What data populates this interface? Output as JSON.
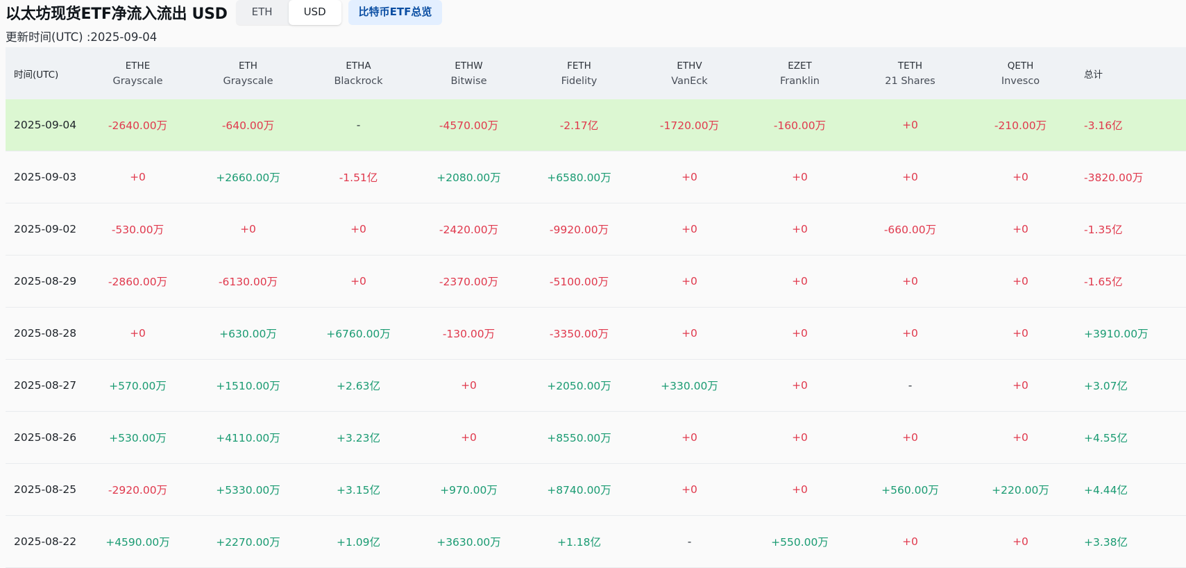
{
  "header": {
    "title": "以太坊现货ETF净流入流出 USD",
    "toggle_options": [
      "ETH",
      "USD"
    ],
    "active_toggle": "USD",
    "btc_link": "比特币ETF总览"
  },
  "update_label": "更新时间(UTC) :2025-09-04",
  "colors": {
    "negative": "#e0394d",
    "positive": "#1a9b72",
    "highlight_row": "#dcf7d2"
  },
  "table": {
    "date_header": "时间(UTC)",
    "total_header": "总计",
    "funds": [
      {
        "symbol": "ETHE",
        "issuer": "Grayscale"
      },
      {
        "symbol": "ETH",
        "issuer": "Grayscale"
      },
      {
        "symbol": "ETHA",
        "issuer": "Blackrock"
      },
      {
        "symbol": "ETHW",
        "issuer": "Bitwise"
      },
      {
        "symbol": "FETH",
        "issuer": "Fidelity"
      },
      {
        "symbol": "ETHV",
        "issuer": "VanEck"
      },
      {
        "symbol": "EZET",
        "issuer": "Franklin"
      },
      {
        "symbol": "TETH",
        "issuer": "21 Shares"
      },
      {
        "symbol": "QETH",
        "issuer": "Invesco"
      }
    ],
    "rows": [
      {
        "date": "2025-09-04",
        "highlight": true,
        "values": [
          "-2640.00万",
          "-640.00万",
          "-",
          "-4570.00万",
          "-2.17亿",
          "-1720.00万",
          "-160.00万",
          "+0",
          "-210.00万"
        ],
        "total": "-3.16亿"
      },
      {
        "date": "2025-09-03",
        "highlight": false,
        "values": [
          "+0",
          "+2660.00万",
          "-1.51亿",
          "+2080.00万",
          "+6580.00万",
          "+0",
          "+0",
          "+0",
          "+0"
        ],
        "total": "-3820.00万"
      },
      {
        "date": "2025-09-02",
        "highlight": false,
        "values": [
          "-530.00万",
          "+0",
          "+0",
          "-2420.00万",
          "-9920.00万",
          "+0",
          "+0",
          "-660.00万",
          "+0"
        ],
        "total": "-1.35亿"
      },
      {
        "date": "2025-08-29",
        "highlight": false,
        "values": [
          "-2860.00万",
          "-6130.00万",
          "+0",
          "-2370.00万",
          "-5100.00万",
          "+0",
          "+0",
          "+0",
          "+0"
        ],
        "total": "-1.65亿"
      },
      {
        "date": "2025-08-28",
        "highlight": false,
        "values": [
          "+0",
          "+630.00万",
          "+6760.00万",
          "-130.00万",
          "-3350.00万",
          "+0",
          "+0",
          "+0",
          "+0"
        ],
        "total": "+3910.00万"
      },
      {
        "date": "2025-08-27",
        "highlight": false,
        "values": [
          "+570.00万",
          "+1510.00万",
          "+2.63亿",
          "+0",
          "+2050.00万",
          "+330.00万",
          "+0",
          "-",
          "+0"
        ],
        "total": "+3.07亿"
      },
      {
        "date": "2025-08-26",
        "highlight": false,
        "values": [
          "+530.00万",
          "+4110.00万",
          "+3.23亿",
          "+0",
          "+8550.00万",
          "+0",
          "+0",
          "+0",
          "+0"
        ],
        "total": "+4.55亿"
      },
      {
        "date": "2025-08-25",
        "highlight": false,
        "values": [
          "-2920.00万",
          "+5330.00万",
          "+3.15亿",
          "+970.00万",
          "+8740.00万",
          "+0",
          "+0",
          "+560.00万",
          "+220.00万"
        ],
        "total": "+4.44亿"
      },
      {
        "date": "2025-08-22",
        "highlight": false,
        "values": [
          "+4590.00万",
          "+2270.00万",
          "+1.09亿",
          "+3630.00万",
          "+1.18亿",
          "-",
          "+550.00万",
          "+0",
          "+0"
        ],
        "total": "+3.38亿"
      }
    ]
  }
}
